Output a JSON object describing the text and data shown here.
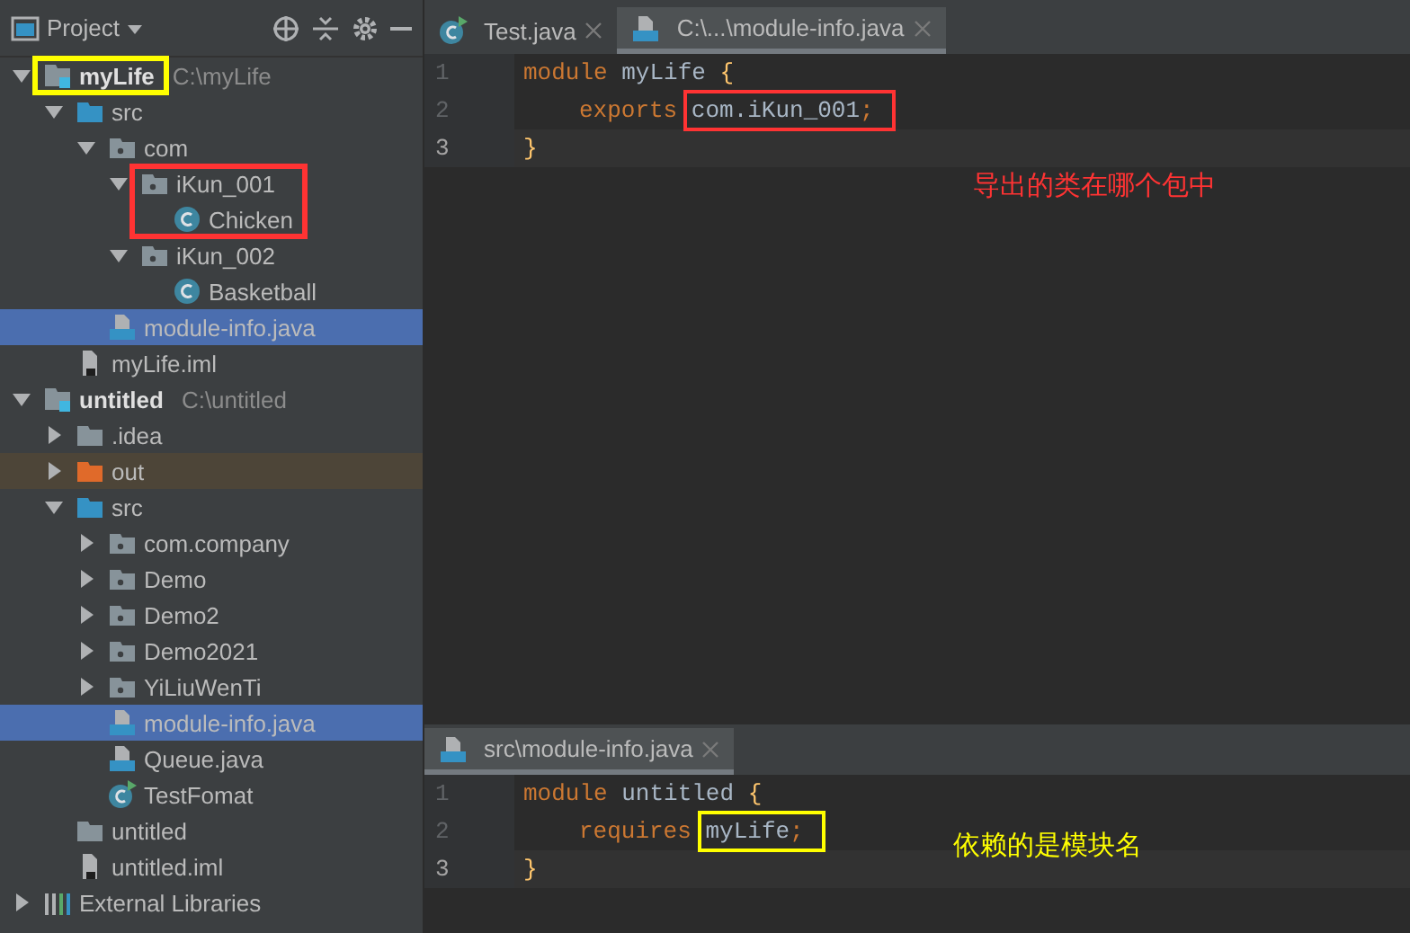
{
  "project_panel": {
    "title": "Project",
    "tree": [
      {
        "label": "myLife",
        "kind": "module",
        "path": "C:\\myLife",
        "expanded": true,
        "selected": false,
        "box": {
          "color": "#ffff00",
          "covers_children": false
        },
        "children": [
          {
            "label": "src",
            "kind": "src",
            "expanded": true,
            "selected": false,
            "children": [
              {
                "label": "com",
                "kind": "package",
                "expanded": true,
                "selected": false,
                "children": [
                  {
                    "label": "iKun_001",
                    "kind": "package",
                    "expanded": true,
                    "selected": false,
                    "box": {
                      "color": "#ff3333",
                      "covers_children": true
                    },
                    "children": [
                      {
                        "label": "Chicken",
                        "kind": "class",
                        "selected": false
                      }
                    ]
                  },
                  {
                    "label": "iKun_002",
                    "kind": "package",
                    "expanded": true,
                    "selected": false,
                    "children": [
                      {
                        "label": "Basketball",
                        "kind": "class",
                        "selected": false
                      }
                    ]
                  }
                ]
              },
              {
                "label": "module-info.java",
                "kind": "java",
                "selected": true
              }
            ]
          },
          {
            "label": "myLife.iml",
            "kind": "iml",
            "selected": false
          }
        ]
      },
      {
        "label": "untitled",
        "kind": "module",
        "path": "C:\\untitled",
        "expanded": true,
        "selected": false,
        "children": [
          {
            "label": ".idea",
            "kind": "folder",
            "expanded": false,
            "selected": false
          },
          {
            "label": "out",
            "kind": "excluded",
            "expanded": false,
            "selected": false
          },
          {
            "label": "src",
            "kind": "src",
            "expanded": true,
            "selected": false,
            "children": [
              {
                "label": "com.company",
                "kind": "package",
                "expanded": false,
                "selected": false
              },
              {
                "label": "Demo",
                "kind": "package",
                "expanded": false,
                "selected": false
              },
              {
                "label": "Demo2",
                "kind": "package",
                "expanded": false,
                "selected": false
              },
              {
                "label": "Demo2021",
                "kind": "package",
                "expanded": false,
                "selected": false
              },
              {
                "label": "YiLiuWenTi",
                "kind": "package",
                "expanded": false,
                "selected": false
              },
              {
                "label": "module-info.java",
                "kind": "java",
                "selected": true
              },
              {
                "label": "Queue.java",
                "kind": "java",
                "selected": false
              },
              {
                "label": "TestFomat",
                "kind": "runclass",
                "selected": false
              }
            ]
          },
          {
            "label": "untitled",
            "kind": "folder",
            "selected": false
          },
          {
            "label": "untitled.iml",
            "kind": "iml",
            "selected": false
          }
        ]
      },
      {
        "label": "External Libraries",
        "kind": "libraries",
        "expanded": false,
        "selected": false
      }
    ]
  },
  "editors": [
    {
      "tabs": [
        {
          "label": "Test.java",
          "kind": "runclass",
          "selected": false
        },
        {
          "label": "C:\\...\\module-info.java",
          "kind": "java",
          "selected": true
        }
      ],
      "lines": [
        {
          "number": "1",
          "current": false,
          "tokens": [
            {
              "kind": "keyword",
              "text": "module"
            },
            {
              "kind": "ident",
              "text": "myLife"
            },
            {
              "kind": "brace",
              "text": "{"
            }
          ],
          "children": [
            {
              "number": "2",
              "current": false,
              "tokens": [
                {
                  "kind": "keyword",
                  "text": "exports"
                },
                {
                  "kind": "group",
                  "box": {
                    "color": "#ff3333"
                  },
                  "tokens": [
                    {
                      "kind": "ident",
                      "text": "com.iKun_001"
                    },
                    {
                      "kind": "punct",
                      "text": ";"
                    }
                  ]
                }
              ]
            }
          ]
        },
        {
          "number": "3",
          "current": true,
          "tokens": [
            {
              "kind": "brace",
              "text": "}"
            }
          ]
        }
      ],
      "note": {
        "text": "导出的类在哪个包中",
        "color": "#ff3333"
      }
    },
    {
      "tabs": [
        {
          "label": "src\\module-info.java",
          "kind": "java",
          "selected": true
        }
      ],
      "lines": [
        {
          "number": "1",
          "current": false,
          "tokens": [
            {
              "kind": "keyword",
              "text": "module"
            },
            {
              "kind": "ident",
              "text": "untitled"
            },
            {
              "kind": "brace",
              "text": "{"
            }
          ],
          "children": [
            {
              "number": "2",
              "current": false,
              "tokens": [
                {
                  "kind": "keyword",
                  "text": "requires"
                },
                {
                  "kind": "group",
                  "box": {
                    "color": "#ffff00"
                  },
                  "tokens": [
                    {
                      "kind": "ident",
                      "text": "myLife"
                    },
                    {
                      "kind": "punct",
                      "text": ";"
                    }
                  ]
                }
              ]
            }
          ]
        },
        {
          "number": "3",
          "current": true,
          "tokens": [
            {
              "kind": "brace",
              "text": "}"
            }
          ]
        }
      ],
      "note": {
        "text": "依赖的是模块名",
        "color": "#ffff00"
      }
    }
  ]
}
